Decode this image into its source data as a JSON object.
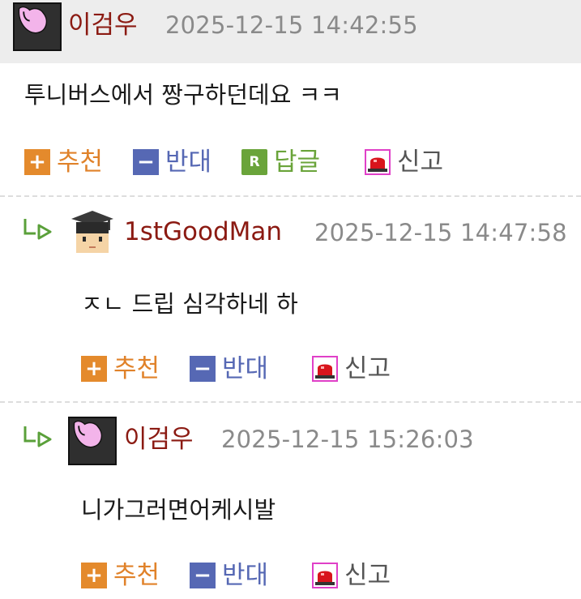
{
  "comments": [
    {
      "username": "이검우",
      "timestamp": "2025-12-15 14:42:55",
      "content": "투니버스에서 짱구하던데요 ㅋㅋ",
      "avatar_icon": "pink-blob-avatar",
      "is_reply": false,
      "actions": {
        "upvote": "추천",
        "downvote": "반대",
        "reply": "답글",
        "report": "신고"
      }
    },
    {
      "username": "1stGoodMan",
      "timestamp": "2025-12-15 14:47:58",
      "content": "ㅈㄴ 드립 심각하네 하",
      "avatar_icon": "graduate-avatar",
      "is_reply": true,
      "actions": {
        "upvote": "추천",
        "downvote": "반대",
        "report": "신고"
      }
    },
    {
      "username": "이검우",
      "timestamp": "2025-12-15 15:26:03",
      "content": "니가그러면어케시발",
      "avatar_icon": "pink-blob-avatar",
      "is_reply": true,
      "actions": {
        "upvote": "추천",
        "downvote": "반대",
        "report": "신고"
      }
    }
  ],
  "icons": {
    "upvote": "plus-icon",
    "downvote": "minus-icon",
    "reply": "reply-r-icon",
    "report": "siren-icon",
    "reply_marker": "reply-arrow-icon"
  },
  "colors": {
    "username": "#8b1a12",
    "timestamp": "#8a8a8a",
    "upvote": "#e48a2c",
    "downvote": "#5668b4",
    "reply": "#6aa43a",
    "report_bg": "#e040c8",
    "header_band": "#ededed"
  }
}
